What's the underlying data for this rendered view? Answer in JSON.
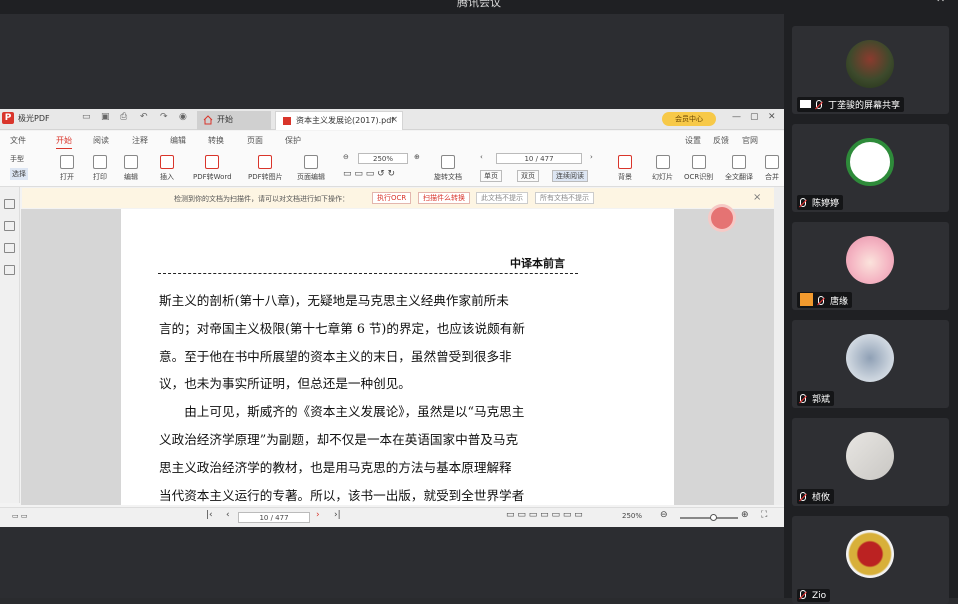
{
  "meeting": {
    "title": "腾讯会议"
  },
  "pdf": {
    "app_name": "极光PDF",
    "tabs": [
      {
        "label": "开始"
      },
      {
        "label": "资本主义发展论(2017).pdf"
      }
    ],
    "vip_label": "会员中心",
    "menu": [
      "文件",
      "开始",
      "阅读",
      "注释",
      "编辑",
      "转换",
      "页面",
      "保护",
      "设置",
      "反馈",
      "官网"
    ],
    "toolbar": {
      "hand": "手型",
      "select": "选择",
      "open": "打开",
      "print": "打印",
      "edit": "编辑",
      "insert": "插入",
      "pdf_word": "PDF转Word",
      "pdf_image": "PDF转图片",
      "page_edit": "页面编辑",
      "zoom": "250%",
      "rotate": "旋转文档",
      "page": "10 / 477",
      "single": "单页",
      "double": "双页",
      "continuous": "连续阅读",
      "background": "背景",
      "slideshow": "幻灯片",
      "ocr": "OCR识别",
      "full_translate": "全文翻译",
      "merge": "合并"
    },
    "notice": {
      "message": "检测到你的文档为扫描件，请可以对文档进行如下操作：",
      "btn_ocr": "执行OCR",
      "btn_image": "扫描件么转换",
      "btn_this_doc": "此文档不提示",
      "btn_all_doc": "所有文档不提示"
    },
    "page_content": {
      "header": "中译本前言",
      "lines": [
        "斯主义的剖析(第十八章)，无疑地是马克思主义经典作家前所未",
        "言的；对帝国主义极限(第十七章第 6 节)的界定，也应该说颇有新",
        "意。至于他在书中所展望的资本主义的末日，虽然曾受到很多非",
        "议，也未为事实所证明，但总还是一种创见。",
        "由上可见，斯威齐的《资本主义发展论》，虽然是以“马克思主",
        "义政治经济学原理”为副题，却不仅是一本在英语国家中普及马克",
        "思主义政治经济学的教材，也是用马克思的方法与基本原理解释",
        "当代资本主义运行的专著。所以，该书一出版，就受到全世界学者"
      ]
    },
    "status": {
      "page": "10 / 477",
      "zoom": "250%"
    }
  },
  "participants": [
    {
      "name": "丁垄骏的屏幕共享",
      "icon": "screen-share-icon",
      "muted": true
    },
    {
      "name": "陈婷婷",
      "muted": true
    },
    {
      "name": "唐缘",
      "icon": "user-icon",
      "muted": true
    },
    {
      "name": "郭斌",
      "muted": true
    },
    {
      "name": "桢攸",
      "muted": true
    },
    {
      "name": "Zio",
      "muted": true
    }
  ]
}
